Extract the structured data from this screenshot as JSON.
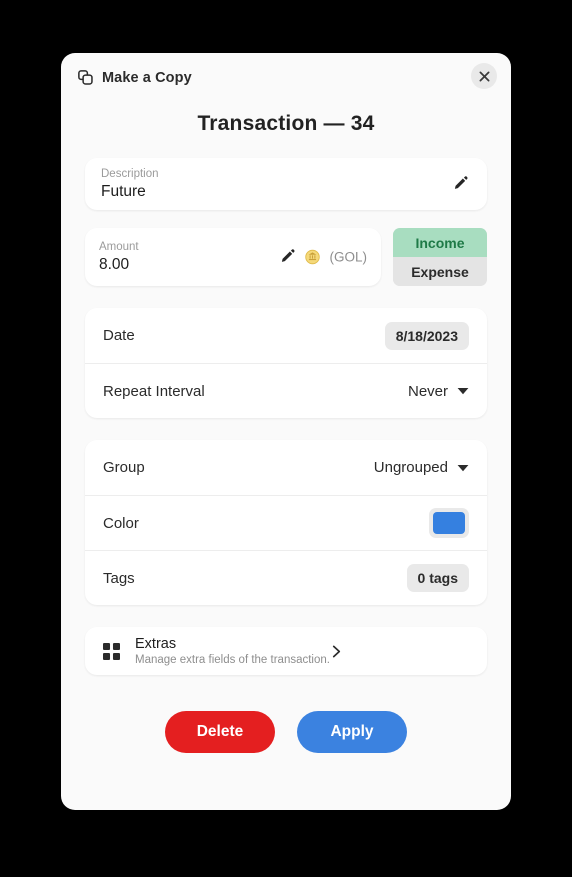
{
  "dialog": {
    "copy_action_label": "Make a Copy",
    "copy_icon": "copy-icon",
    "close_icon": "close-icon",
    "heading": "Transaction — 34"
  },
  "description": {
    "label": "Description",
    "value": "Future",
    "edit_icon": "pencil-icon"
  },
  "amount": {
    "label": "Amount",
    "value": "8.00",
    "edit_icon": "pencil-icon",
    "currency_icon": "coin-icon",
    "currency_code": "(GOL)"
  },
  "type_toggle": {
    "income_label": "Income",
    "expense_label": "Expense",
    "selected": "Income",
    "selected_bg": "#a8ddc0",
    "selected_fg": "#1f7a47",
    "unselected_bg": "#e4e4e4"
  },
  "schedule": {
    "date_label": "Date",
    "date_value": "8/18/2023",
    "repeat_label": "Repeat Interval",
    "repeat_value": "Never",
    "repeat_caret_icon": "chevron-down-icon"
  },
  "organize": {
    "group_label": "Group",
    "group_value": "Ungrouped",
    "group_caret_icon": "chevron-down-icon",
    "color_label": "Color",
    "color_value": "#3580e0",
    "tags_label": "Tags",
    "tags_value": "0 tags"
  },
  "extras": {
    "icon": "grid-icon",
    "title": "Extras",
    "subtitle": "Manage extra fields of the transaction.",
    "chevron_icon": "chevron-right-icon"
  },
  "footer": {
    "delete_label": "Delete",
    "delete_color": "#e41f20",
    "apply_label": "Apply",
    "apply_color": "#3b82e0"
  }
}
